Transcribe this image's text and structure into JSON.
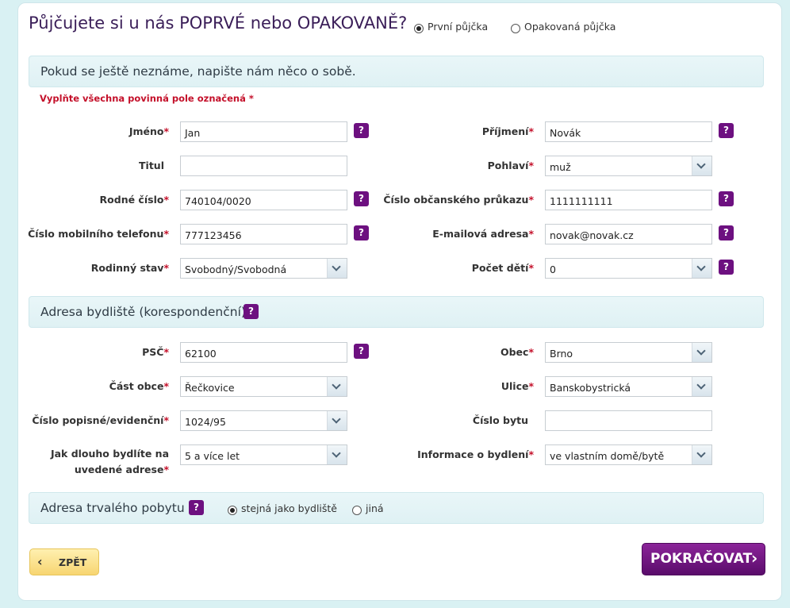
{
  "header": {
    "title": "Půjčujete si u nás POPRVÉ nebo OPAKOVANĚ?",
    "options": [
      {
        "label": "První půjčka",
        "checked": true
      },
      {
        "label": "Opakovaná půjčka",
        "checked": false
      }
    ]
  },
  "personal": {
    "section_title": "Pokud se ještě neznáme, napište nám něco o sobě.",
    "required_note": "Vyplňte všechna povinná pole označená *",
    "required_mark": "*",
    "help_symbol": "?",
    "first_name": {
      "label": "Jméno",
      "value": "Jan"
    },
    "last_name": {
      "label": "Příjmení",
      "value": "Novák"
    },
    "title": {
      "label": "Titul",
      "value": ""
    },
    "gender": {
      "label": "Pohlaví",
      "value": "muž"
    },
    "birth_number": {
      "label": "Rodné číslo",
      "value": "740104/0020"
    },
    "id_card": {
      "label": "Číslo občanského průkazu",
      "value": "1111111111"
    },
    "mobile": {
      "label": "Číslo mobilního telefonu",
      "value": "777123456"
    },
    "email": {
      "label": "E-mailová adresa",
      "value": "novak@novak.cz"
    },
    "marital_status": {
      "label": "Rodinný stav",
      "value": "Svobodný/Svobodná"
    },
    "children": {
      "label": "Počet dětí",
      "value": "0"
    }
  },
  "address": {
    "section_title": "Adresa bydliště (korespondenční)",
    "zip": {
      "label": "PSČ",
      "value": "62100"
    },
    "city": {
      "label": "Obec",
      "value": "Brno"
    },
    "district": {
      "label": "Část obce",
      "value": "Řečkovice"
    },
    "street": {
      "label": "Ulice",
      "value": "Banskobystrická"
    },
    "house_number": {
      "label": "Číslo popisné/evidenční",
      "value": "1024/95"
    },
    "flat_number": {
      "label": "Číslo bytu",
      "value": ""
    },
    "living_duration": {
      "label_line1": "Jak dlouho bydlíte na",
      "label_line2": "uvedené adrese",
      "value": "5 a více let"
    },
    "housing_info": {
      "label": "Informace o bydlení",
      "value": "ve vlastním domě/bytě"
    }
  },
  "permanent": {
    "section_title": "Adresa trvalého pobytu",
    "options": [
      {
        "label": "stejná jako bydliště",
        "checked": true
      },
      {
        "label": "jiná",
        "checked": false
      }
    ]
  },
  "buttons": {
    "back_icon": "‹",
    "back_label": "ZPĚT",
    "next_label": "POKRAČOVAT",
    "next_icon": "›"
  }
}
